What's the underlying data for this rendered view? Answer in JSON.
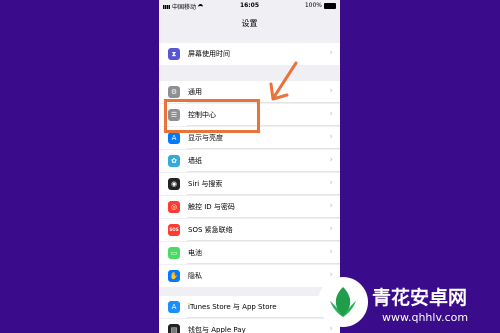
{
  "status_bar": {
    "carrier": "中国移动",
    "time": "16:05",
    "battery": "100%"
  },
  "nav_title": "设置",
  "items": [
    {
      "label": "屏幕使用时间",
      "icon": "hourglass-icon",
      "color": "#5856d6"
    },
    {
      "label": "通用",
      "icon": "gear-icon",
      "color": "#8e8e93"
    },
    {
      "label": "控制中心",
      "icon": "toggles-icon",
      "color": "#8e8e93"
    },
    {
      "label": "显示与亮度",
      "icon": "brightness-icon",
      "color": "#007aff"
    },
    {
      "label": "墙纸",
      "icon": "flower-icon",
      "color": "#34aadc"
    },
    {
      "label": "Siri 与搜索",
      "icon": "siri-icon",
      "color": "#222222"
    },
    {
      "label": "触控 ID 与密码",
      "icon": "fingerprint-icon",
      "color": "#ff3b30"
    },
    {
      "label": "SOS 紧急联络",
      "icon": "sos-icon",
      "color": "#ff3b30"
    },
    {
      "label": "电池",
      "icon": "battery-icon",
      "color": "#4cd964"
    },
    {
      "label": "隐私",
      "icon": "hand-icon",
      "color": "#007aff"
    },
    {
      "label": "iTunes Store 与 App Store",
      "icon": "app-store-icon",
      "color": "#1c8ef9"
    },
    {
      "label": "钱包与 Apple Pay",
      "icon": "wallet-icon",
      "color": "#222222"
    }
  ],
  "highlight_color": "#e8743b",
  "watermark": {
    "text": "青花安卓网",
    "url": "www.qhhlv.com"
  }
}
